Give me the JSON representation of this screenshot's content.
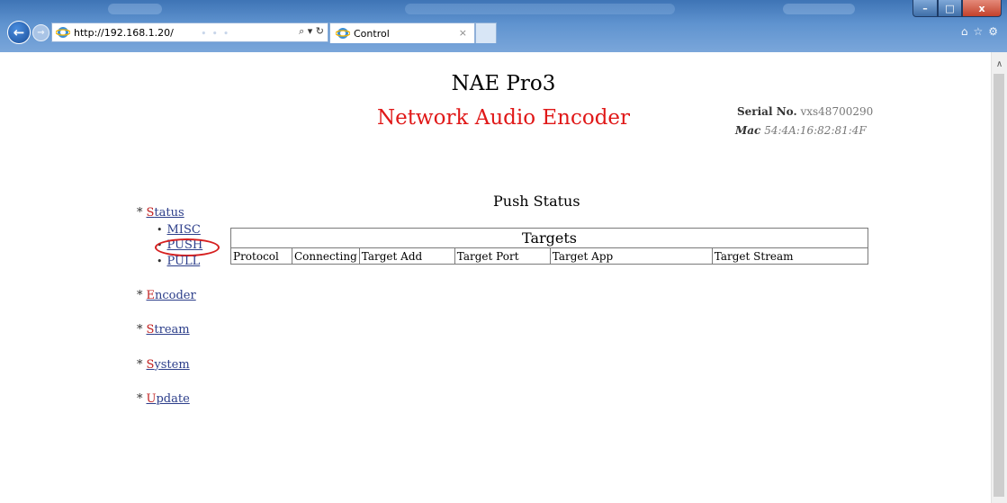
{
  "browser": {
    "url": "http://192.168.1.20/",
    "tab_title": "Control",
    "tab_close": "×",
    "window_buttons": {
      "minimize": "–",
      "maximize": "□",
      "close": "x"
    },
    "toolbar_icons": [
      "home-icon",
      "star-icon",
      "gear-icon"
    ]
  },
  "header": {
    "title": "NAE Pro3",
    "subtitle": "Network Audio Encoder",
    "serial_label": "Serial No.",
    "serial_value": "vxs48700290",
    "mac_label": "Mac",
    "mac_value": "54:4A:16:82:81:4F"
  },
  "nav": {
    "items": [
      {
        "label_first": "S",
        "label_rest": "tatus"
      },
      {
        "label_first": "E",
        "label_rest": "ncoder"
      },
      {
        "label_first": "S",
        "label_rest": "tream"
      },
      {
        "label_first": "S",
        "label_rest": "ystem"
      },
      {
        "label_first": "U",
        "label_rest": "pdate"
      }
    ],
    "sub_items": [
      "MISC",
      "PUSH",
      "PULL"
    ]
  },
  "main": {
    "section_title": "Push Status",
    "table": {
      "caption": "Targets",
      "columns": [
        "Protocol",
        "Connecting",
        "Target Add",
        "Target Port",
        "Target App",
        "Target Stream"
      ]
    }
  },
  "colors": {
    "title_red": "#e01818",
    "link_blue": "#2c3e8a",
    "accent_red": "#c02020",
    "chrome_blue": "#5f93cf"
  }
}
